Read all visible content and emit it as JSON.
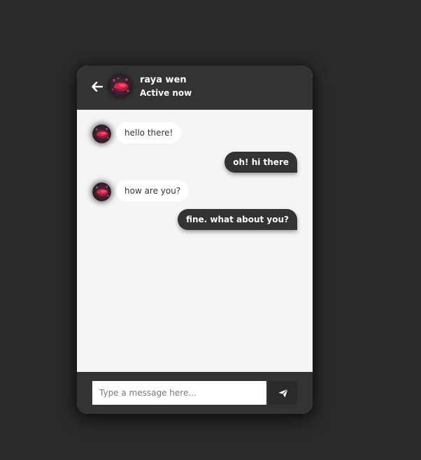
{
  "header": {
    "contact_name": "raya wen",
    "status": "Active now",
    "back_icon": "arrow-left-icon",
    "avatar_icon": "avatar"
  },
  "messages": [
    {
      "direction": "incoming",
      "text": "hello there!"
    },
    {
      "direction": "outgoing",
      "text": "oh! hi there"
    },
    {
      "direction": "incoming",
      "text": "how are you?"
    },
    {
      "direction": "outgoing",
      "text": "fine. what about you?"
    }
  ],
  "composer": {
    "placeholder": "Type a message here...",
    "value": "",
    "send_icon": "paper-plane-icon"
  },
  "colors": {
    "page_background": "#2a2a2a",
    "header_background": "#333333",
    "chat_background": "#f5f5f5",
    "incoming_bubble": "#ffffff",
    "outgoing_bubble": "#333333",
    "avatar_accent": "#d6264a"
  }
}
